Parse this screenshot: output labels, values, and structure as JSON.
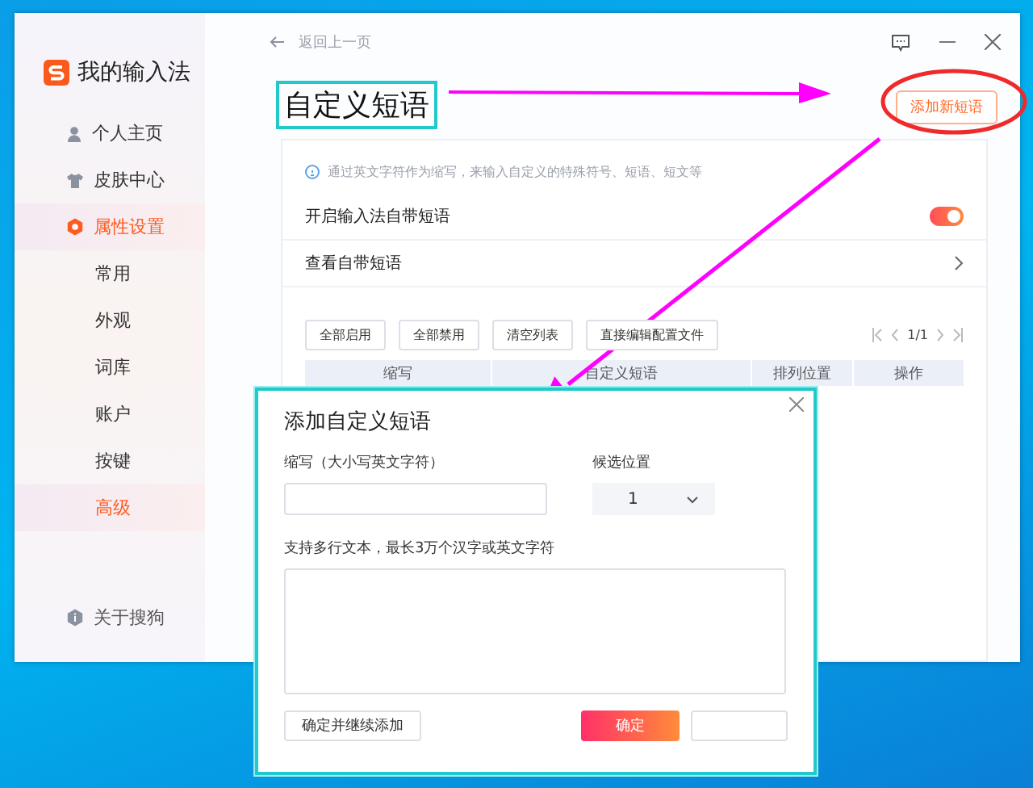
{
  "app": {
    "title": "我的输入法"
  },
  "sidebar": {
    "items": [
      {
        "label": "个人主页",
        "kind": "main",
        "selected": false
      },
      {
        "label": "皮肤中心",
        "kind": "main",
        "selected": false
      },
      {
        "label": "属性设置",
        "kind": "main",
        "selected": true
      },
      {
        "label": "常用",
        "kind": "sub",
        "selected": false
      },
      {
        "label": "外观",
        "kind": "sub",
        "selected": false
      },
      {
        "label": "词库",
        "kind": "sub",
        "selected": false
      },
      {
        "label": "账户",
        "kind": "sub",
        "selected": false
      },
      {
        "label": "按键",
        "kind": "sub",
        "selected": false
      },
      {
        "label": "高级",
        "kind": "sub",
        "selected": true
      }
    ],
    "footer": "关于搜狗"
  },
  "back_link": "返回上一页",
  "page_title": "自定义短语",
  "add_button": "添加新短语",
  "tip": "通过英文字符作为缩写，来输入自定义的特殊符号、短语、短文等",
  "settings": [
    {
      "label": "开启输入法自带短语",
      "kind": "toggle",
      "on": true
    },
    {
      "label": "查看自带短语",
      "kind": "link"
    }
  ],
  "actions": [
    "全部启用",
    "全部禁用",
    "清空列表",
    "直接编辑配置文件"
  ],
  "pagination": {
    "page": "1/1"
  },
  "table": {
    "columns": [
      "缩写",
      "自定义短语",
      "排列位置",
      "操作"
    ]
  },
  "dialog": {
    "title": "添加自定义短语",
    "abbr_label": "缩写（大小写英文字符）",
    "position_label": "候选位置",
    "position_value": "1",
    "text_label": "支持多行文本，最长3万个汉字或英文字符",
    "continue_button": "确定并继续添加",
    "ok_button": "确定"
  }
}
